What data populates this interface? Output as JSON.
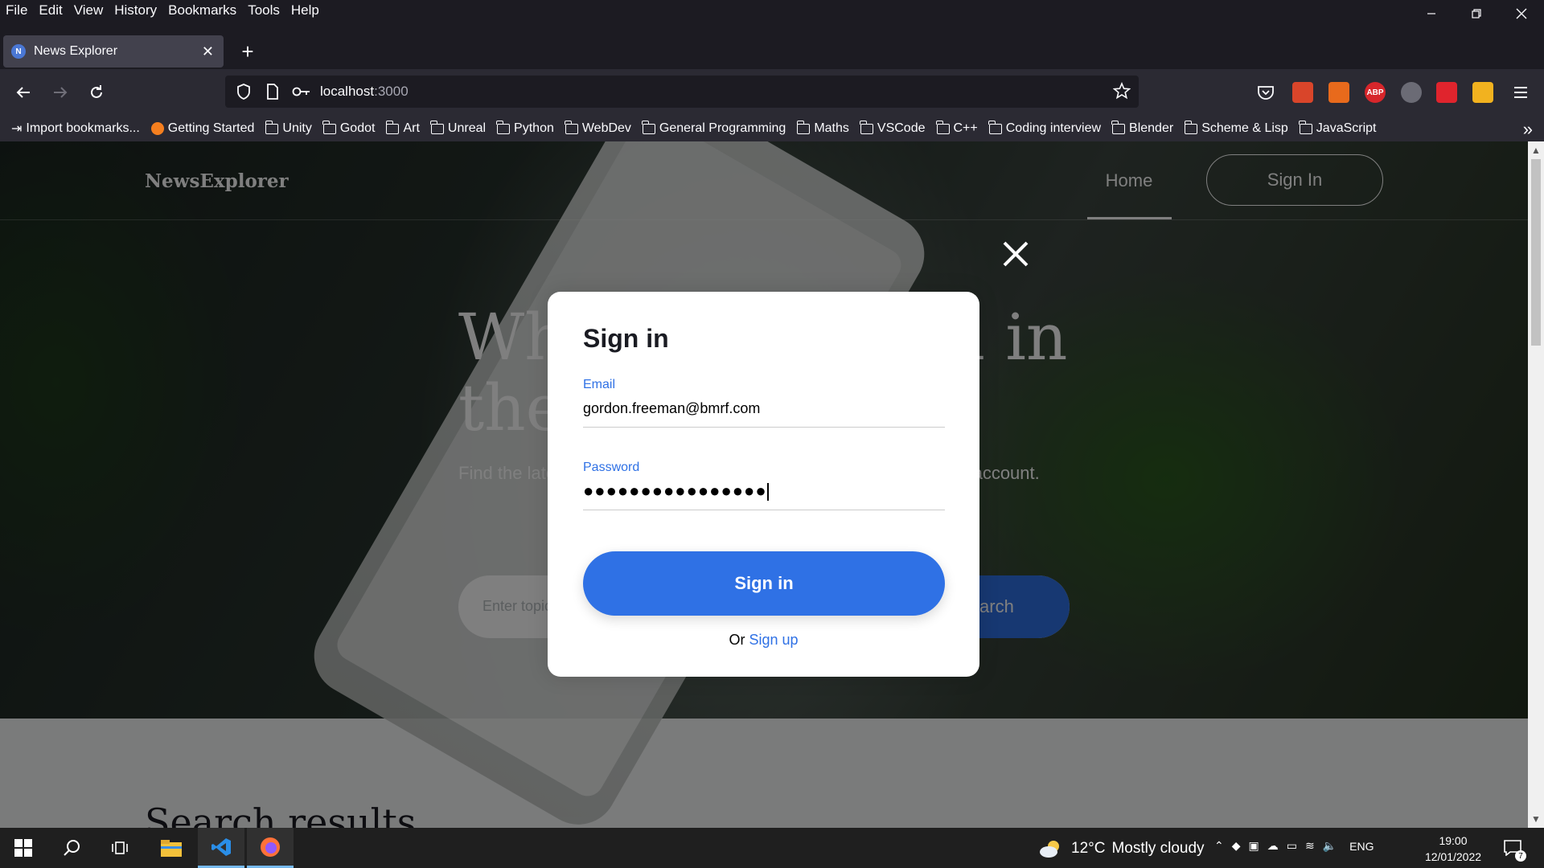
{
  "menubar": [
    "File",
    "Edit",
    "View",
    "History",
    "Bookmarks",
    "Tools",
    "Help"
  ],
  "tab": {
    "title": "News Explorer",
    "favicon_letter": "N"
  },
  "urlbar": {
    "host": "localhost",
    "port": ":3000"
  },
  "bookmarks": [
    {
      "label": "Import bookmarks...",
      "type": "import"
    },
    {
      "label": "Getting Started",
      "type": "firefox"
    },
    {
      "label": "Unity",
      "type": "folder"
    },
    {
      "label": "Godot",
      "type": "folder"
    },
    {
      "label": "Art",
      "type": "folder"
    },
    {
      "label": "Unreal",
      "type": "folder"
    },
    {
      "label": "Python",
      "type": "folder"
    },
    {
      "label": "WebDev",
      "type": "folder"
    },
    {
      "label": "General Programming",
      "type": "folder"
    },
    {
      "label": "Maths",
      "type": "folder"
    },
    {
      "label": "VSCode",
      "type": "folder"
    },
    {
      "label": "C++",
      "type": "folder"
    },
    {
      "label": "Coding interview",
      "type": "folder"
    },
    {
      "label": "Blender",
      "type": "folder"
    },
    {
      "label": "Scheme & Lisp",
      "type": "folder"
    },
    {
      "label": "JavaScript",
      "type": "folder"
    }
  ],
  "extensions": [
    {
      "name": "pocket-icon",
      "color": "#2b2a33",
      "text": ""
    },
    {
      "name": "extension-red-icon",
      "color": "#d9452a",
      "text": ""
    },
    {
      "name": "extension-orange-icon",
      "color": "#e86a1c",
      "text": ""
    },
    {
      "name": "adblock-plus-icon",
      "color": "#d7262b",
      "text": "ABP"
    },
    {
      "name": "extension-gray-icon",
      "color": "#6b6b75",
      "text": ""
    },
    {
      "name": "youtube-extension-icon",
      "color": "#e0242d",
      "text": ""
    },
    {
      "name": "extension-yellow-icon",
      "color": "#f2b21f",
      "text": ""
    }
  ],
  "site": {
    "logo": "NewsExplorer",
    "nav_home": "Home",
    "nav_signin": "Sign In",
    "hero_title": "What's going on in the world?",
    "hero_sub": "Find the latest news on any topic and save them in your personal account.",
    "search_placeholder": "Enter topic",
    "search_button": "Search",
    "results_title": "Search results"
  },
  "modal": {
    "title": "Sign in",
    "email_label": "Email",
    "email_value": "gordon.freeman@bmrf.com",
    "password_label": "Password",
    "password_value": "●●●●●●●●●●●●●●●●",
    "submit": "Sign in",
    "or_text": "Or",
    "signup_link": "Sign up"
  },
  "taskbar": {
    "weather_temp": "12°C",
    "weather_text": "Mostly cloudy",
    "language": "ENG",
    "time": "19:00",
    "date": "12/01/2022",
    "notifications": "7"
  }
}
